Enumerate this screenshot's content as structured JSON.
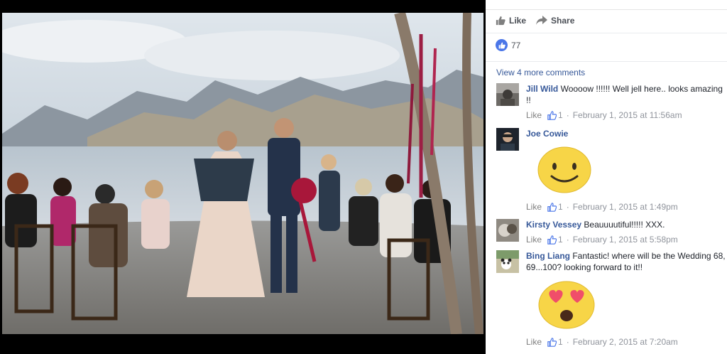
{
  "post": {
    "like_label": "Like",
    "share_label": "Share",
    "like_count": "77",
    "view_more": "View 4 more comments"
  },
  "comments": [
    {
      "author": "Jill Wild",
      "text": "Woooow !!!!!! Well jell here.. looks amazing !!",
      "like_label": "Like",
      "likes": "1",
      "sep": "·",
      "time": "February 1, 2015 at 11:56am"
    },
    {
      "author": "Joe Cowie",
      "text": "",
      "sticker": "smiling-face-sticker",
      "like_label": "Like",
      "likes": "1",
      "sep": "·",
      "time": "February 1, 2015 at 1:49pm"
    },
    {
      "author": "Kirsty Vessey",
      "text": "Beauuuutiful!!!!! XXX.",
      "like_label": "Like",
      "likes": "1",
      "sep": "·",
      "time": "February 1, 2015 at 5:58pm"
    },
    {
      "author": "Bing Liang",
      "text": "Fantastic! where will be the Wedding 68, 69...100? looking forward to it!!",
      "sticker": "heart-eyes-sticker",
      "like_label": "Like",
      "likes": "1",
      "sep": "·",
      "time": "February 2, 2015 at 7:20am"
    }
  ],
  "colors": {
    "link": "#365899",
    "meta": "#90949c",
    "like_badge": "#4a76e8",
    "sticker_yellow": "#f7d547"
  }
}
